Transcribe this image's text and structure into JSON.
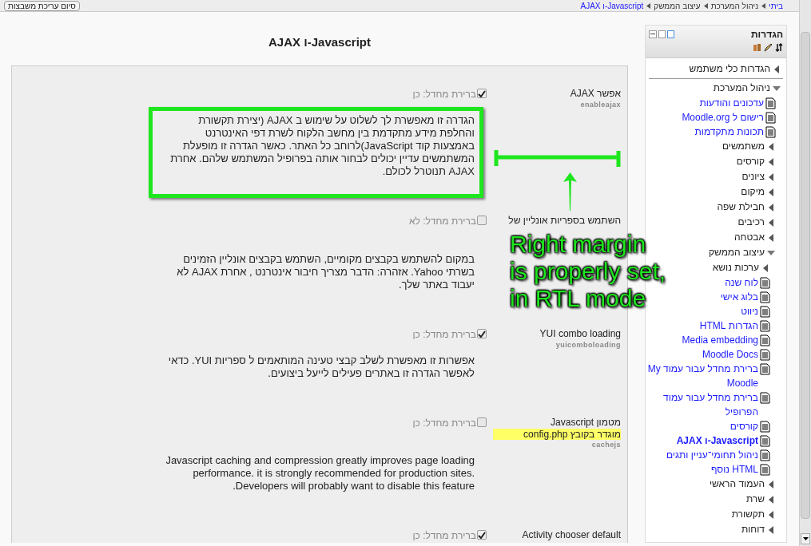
{
  "top_bar": {
    "breadcrumb": [
      {
        "text": "ביתי",
        "link": true
      },
      {
        "text": "ניהול המערכת",
        "link": false
      },
      {
        "text": "עיצוב הממשק",
        "link": false
      },
      {
        "text": "Javascript-ו AJAX",
        "link": true
      }
    ],
    "button": "סיום עריכת משבצות"
  },
  "page_title": "Javascript-ו AJAX",
  "settings": [
    {
      "label": "אפשר AJAX",
      "key": "enableajax",
      "checked": true,
      "highlighted": true,
      "default_text": "ברירת מחדל: כן",
      "description": "הגדרה זו מאפשרת לך לשלוט על שימוש ב AJAX (יצירת תקשורת והחלפת מידע מתקדמת בין מחשב הלקוח לשרת דפי האינטרנט באמצעות קוד JavaScript)לרוחב כל האתר. כאשר הגדרה זו מופעלת המשתמשים עדיין יכולים לבחור אותה בפרופיל המשתמש שלהם. אחרת AJAX תנוטרל לכולם."
    },
    {
      "label": "השתמש בספריות אונליין של",
      "checked": false,
      "highlighted": false,
      "default_text": "ברירת מחדל: לא",
      "description": "במקום להשתמש בקבצים מקומיים, השתמש בקבצים אונליין הזמינים בשרתי Yahoo. אזהרה: הדבר מצריך חיבור אינטרנט , אחרת AJAX לא יעבוד באתר שלך."
    },
    {
      "label": "YUI combo loading",
      "key": "yuicomboloading",
      "checked": true,
      "highlighted": false,
      "default_text": "ברירת מחדל: כן",
      "description": "אפשרות זו מאפשרת לשלב קבצי טעינה המותאמים ל ספריות YUI. כדאי לאפשר הגדרה זו באתרים פעילים לייעל ביצועים."
    },
    {
      "label": "מטמון Javascript",
      "highlighted": false,
      "note": "מוגדר בקובץ config.php",
      "key": "cachejs",
      "checked": false,
      "default_text": "ברירת מחדל: כן",
      "description": "Javascript caching and compression greatly improves page loading performance. it is strongly recommended for production sites. Developers will probably want to disable this feature."
    },
    {
      "label": "Activity chooser default",
      "checked": true,
      "default_text": "ברירת מחדל: כן"
    }
  ],
  "settings_block": {
    "title": "הגדרות",
    "items": [
      {
        "label": "הגדרות כלי משתמש",
        "kind": "folder",
        "expanded": false
      },
      {
        "label": "ניהול המערכת",
        "kind": "folder",
        "expanded": true,
        "children": [
          {
            "label": "עדכונים והודעות",
            "kind": "page",
            "selected": false
          },
          {
            "label": "רישום ל Moodle.org",
            "kind": "page",
            "selected": false
          },
          {
            "label": "תכונות מתקדמות",
            "kind": "page",
            "selected": false
          },
          {
            "label": "משתמשים",
            "kind": "folder",
            "expanded": false
          },
          {
            "label": "קורסים",
            "kind": "folder",
            "expanded": false
          },
          {
            "label": "ציונים",
            "kind": "folder",
            "expanded": false
          },
          {
            "label": "מיקום",
            "kind": "folder",
            "expanded": false
          },
          {
            "label": "חבילת שפה",
            "kind": "folder",
            "expanded": false
          },
          {
            "label": "רכיבים",
            "kind": "folder",
            "expanded": false
          },
          {
            "label": "אבטחה",
            "kind": "folder",
            "expanded": false
          },
          {
            "label": "עיצוב הממשק",
            "kind": "folder",
            "expanded": true,
            "children": [
              {
                "label": "ערכות נושא",
                "kind": "folder",
                "expanded": false
              },
              {
                "label": "לוח שנה",
                "kind": "page",
                "selected": false
              },
              {
                "label": "בלוג אישי",
                "kind": "page",
                "selected": false
              },
              {
                "label": "ניווט",
                "kind": "page",
                "selected": false
              },
              {
                "label": "הגדרות HTML",
                "kind": "page",
                "selected": false
              },
              {
                "label": "Media embedding",
                "kind": "page",
                "selected": false
              },
              {
                "label": "Moodle Docs",
                "kind": "page",
                "selected": false
              },
              {
                "label": "ברירת מחדל עבור עמוד My Moodle",
                "kind": "page",
                "selected": false
              },
              {
                "label": "ברירת מחדל עבור עמוד הפרופיל",
                "kind": "page",
                "selected": false
              },
              {
                "label": "קורסים",
                "kind": "page",
                "selected": false
              },
              {
                "label": "Javascript-ו AJAX",
                "kind": "page",
                "selected": true
              },
              {
                "label": "ניהול תחומי־עניין ותגים",
                "kind": "page",
                "selected": false
              },
              {
                "label": "HTML נוסף",
                "kind": "page",
                "selected": false
              }
            ]
          },
          {
            "label": "העמוד הראשי",
            "kind": "folder",
            "expanded": false
          },
          {
            "label": "שרת",
            "kind": "folder",
            "expanded": false
          },
          {
            "label": "תקשורת",
            "kind": "folder",
            "expanded": false
          },
          {
            "label": "דוחות",
            "kind": "folder",
            "expanded": false
          }
        ]
      }
    ]
  },
  "annotation": {
    "lines": [
      "Right margin",
      "is properly set,",
      "in RTL mode"
    ]
  }
}
